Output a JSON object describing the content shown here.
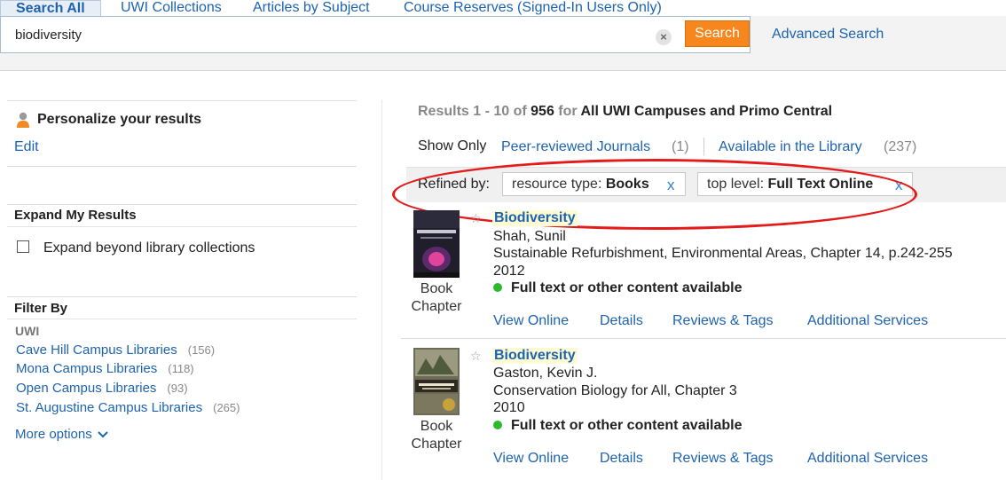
{
  "tabs": [
    {
      "label": "Search All"
    },
    {
      "label": "UWI Collections"
    },
    {
      "label": "Articles by Subject"
    },
    {
      "label": "Course Reserves (Signed-In Users Only)"
    }
  ],
  "search": {
    "query": "biodiversity",
    "clear_icon": "×",
    "button_label": "Search",
    "advanced_label": "Advanced Search"
  },
  "left": {
    "personalize": {
      "title": "Personalize your results",
      "edit_label": "Edit"
    },
    "expand": {
      "title": "Expand My Results",
      "checkbox_label": "Expand beyond library collections",
      "checked": false
    },
    "filter": {
      "title": "Filter By",
      "group_label": "UWI",
      "facets": [
        {
          "label": "Cave Hill Campus Libraries",
          "count": "(156)"
        },
        {
          "label": "Mona Campus Libraries",
          "count": "(118)"
        },
        {
          "label": "Open Campus Libraries",
          "count": "(93)"
        },
        {
          "label": "St. Augustine Campus Libraries",
          "count": "(265)"
        }
      ],
      "more_label": "More options"
    }
  },
  "results_header": {
    "prefix": "Results 1 - 10 of ",
    "total": "956",
    "for_text": " for ",
    "scope": "All UWI Campuses and Primo Central",
    "show_only_label": "Show Only",
    "show_only": [
      {
        "label": "Peer-reviewed Journals",
        "count": "(1)"
      },
      {
        "label": "Available in the Library",
        "count": "(237)"
      }
    ],
    "refined_by_label": "Refined by:",
    "refinements": [
      {
        "key": "resource type: ",
        "value": "Books"
      },
      {
        "key": "top level: ",
        "value": "Full Text Online"
      }
    ],
    "remove_icon": "x"
  },
  "results": [
    {
      "title": "Biodiversity",
      "author": "Shah, Sunil",
      "source": "Sustainable Refurbishment, Environmental Areas, Chapter 14, p.242-255",
      "year": "2012",
      "availability": "Full text or other content available",
      "type_line1": "Book",
      "type_line2": "Chapter",
      "links": [
        "View Online",
        "Details",
        "Reviews & Tags",
        "Additional Services"
      ]
    },
    {
      "title": "Biodiversity",
      "author": "Gaston, Kevin J.",
      "source": "Conservation Biology for All, Chapter 3",
      "year": "2010",
      "availability": "Full text or other content available",
      "type_line1": "Book",
      "type_line2": "Chapter",
      "links": [
        "View Online",
        "Details",
        "Reviews & Tags",
        "Additional Services"
      ]
    }
  ],
  "colors": {
    "accent": "#1d63b0",
    "search_button": "#f7861c",
    "annotation_oval": "#e31b1b",
    "available_dot": "#2eb82e"
  }
}
